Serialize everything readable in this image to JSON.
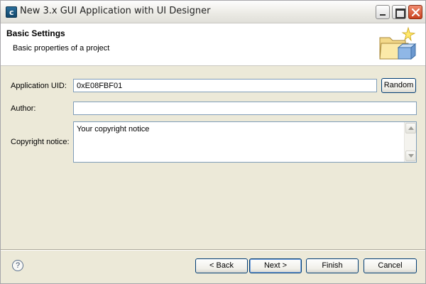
{
  "window": {
    "title": "New 3.x GUI Application with UI Designer",
    "app_icon_glyph": "c"
  },
  "banner": {
    "title": "Basic Settings",
    "description": "Basic properties of a project",
    "icon": "folder-star-icon"
  },
  "form": {
    "uid_label": "Application UID:",
    "uid_value": "0xE08FBF01",
    "random_label": "Random",
    "author_label": "Author:",
    "author_value": "",
    "copyright_label": "Copyright notice:",
    "copyright_value": "Your copyright notice"
  },
  "footer": {
    "help_glyph": "?",
    "back_label": "< Back",
    "next_label": "Next >",
    "finish_label": "Finish",
    "cancel_label": "Cancel"
  },
  "colors": {
    "button_border": "#003c74",
    "field_border": "#7f9db9",
    "dialog_bg": "#ece9d8",
    "close_red": "#c9421f"
  }
}
